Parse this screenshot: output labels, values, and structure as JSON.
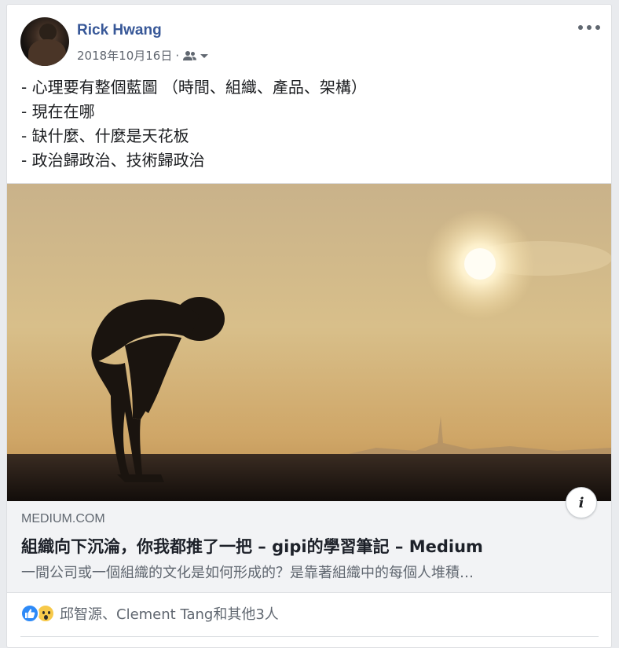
{
  "post": {
    "author": "Rick Hwang",
    "date": "2018年10月16日",
    "separator": "·",
    "audience_icon": "friends-icon",
    "more_icon": "more-dots-icon",
    "lines": [
      "- 心理要有整個藍圖 （時間、組織、產品、架構）",
      "- 現在在哪",
      "- 缺什麼、什麼是天花板",
      "- 政治歸政治、技術歸政治"
    ]
  },
  "link_preview": {
    "domain": "MEDIUM.COM",
    "title": "組織向下沉淪，你我都推了一把 – gipi的學習筆記 – Medium",
    "description": "一間公司或一個組織的文化是如何形成的？是靠著組織中的每個人堆積…",
    "info_button": "i"
  },
  "reactions": {
    "icons": [
      "like-icon",
      "wow-icon"
    ],
    "names": "邱智源、Clement Tang和其他3人"
  },
  "colors": {
    "author_link": "#385898",
    "like_blue": "#2e8af7",
    "wow_yellow": "#f7c94a",
    "background": "#e9ebee"
  }
}
